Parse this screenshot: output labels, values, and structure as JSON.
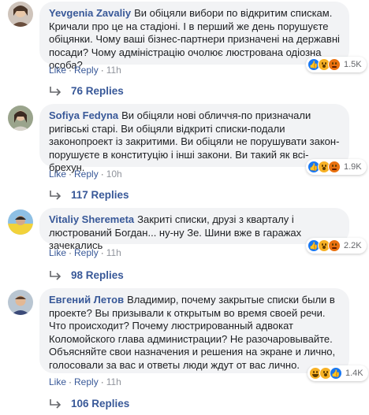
{
  "comments": [
    {
      "author": "Yevgenia Zavaliy",
      "text": "Ви обіцяли вибори по відкритим спискам. Кричали про це на стадіоні. І в перший же день порушуєте обіцянки. Чому ваші бізнес-партнери призначені на державні посади? Чому адміністрацію очолює люстрована одіозна особа?",
      "reaction_count": "1.5K",
      "reactions": [
        "like-icon",
        "wow-icon",
        "angry-icon"
      ],
      "like_label": "Like",
      "reply_label": "Reply",
      "time": "11h",
      "replies_label": "76 Replies"
    },
    {
      "author": "Sofiya Fedyna",
      "text": "Ви обіцяли нові обличчя-по призначали ригівські старі. Ви обіцяли відкриті списки-подали законопроект із закритими. Ви обіцяли не порушувати закон-порушуєте в конституцію і інші закони. Ви такий як всі-брехун.",
      "reaction_count": "1.9K",
      "reactions": [
        "like-icon",
        "wow-icon",
        "angry-icon"
      ],
      "like_label": "Like",
      "reply_label": "Reply",
      "time": "10h",
      "replies_label": "117 Replies"
    },
    {
      "author": "Vitaliy Sheremeta",
      "text": "Закриті списки, друзі з кварталу і люстрований Богдан... ну-ну Зе. Шини вже в гаражах зачекались",
      "reaction_count": "2.2K",
      "reactions": [
        "like-icon",
        "wow-icon",
        "angry-icon"
      ],
      "like_label": "Like",
      "reply_label": "Reply",
      "time": "11h",
      "replies_label": "98 Replies"
    },
    {
      "author": "Евгений Летов",
      "text": "Владимир, почему закрытые списки были в проекте? Вы призывали к открытым во время своей речи. Что происходит? Почему люстрированный адвокат Коломойского глава администрации? Не разочаровывайте. Объясняйте свои назначения и решения на экране и лично, голосовали за вас и ответы люди ждут от вас лично.",
      "reaction_count": "1.4K",
      "reactions": [
        "haha-icon",
        "wow-icon",
        "like-icon"
      ],
      "like_label": "Like",
      "reply_label": "Reply",
      "time": "11h",
      "replies_label": "106 Replies"
    }
  ]
}
